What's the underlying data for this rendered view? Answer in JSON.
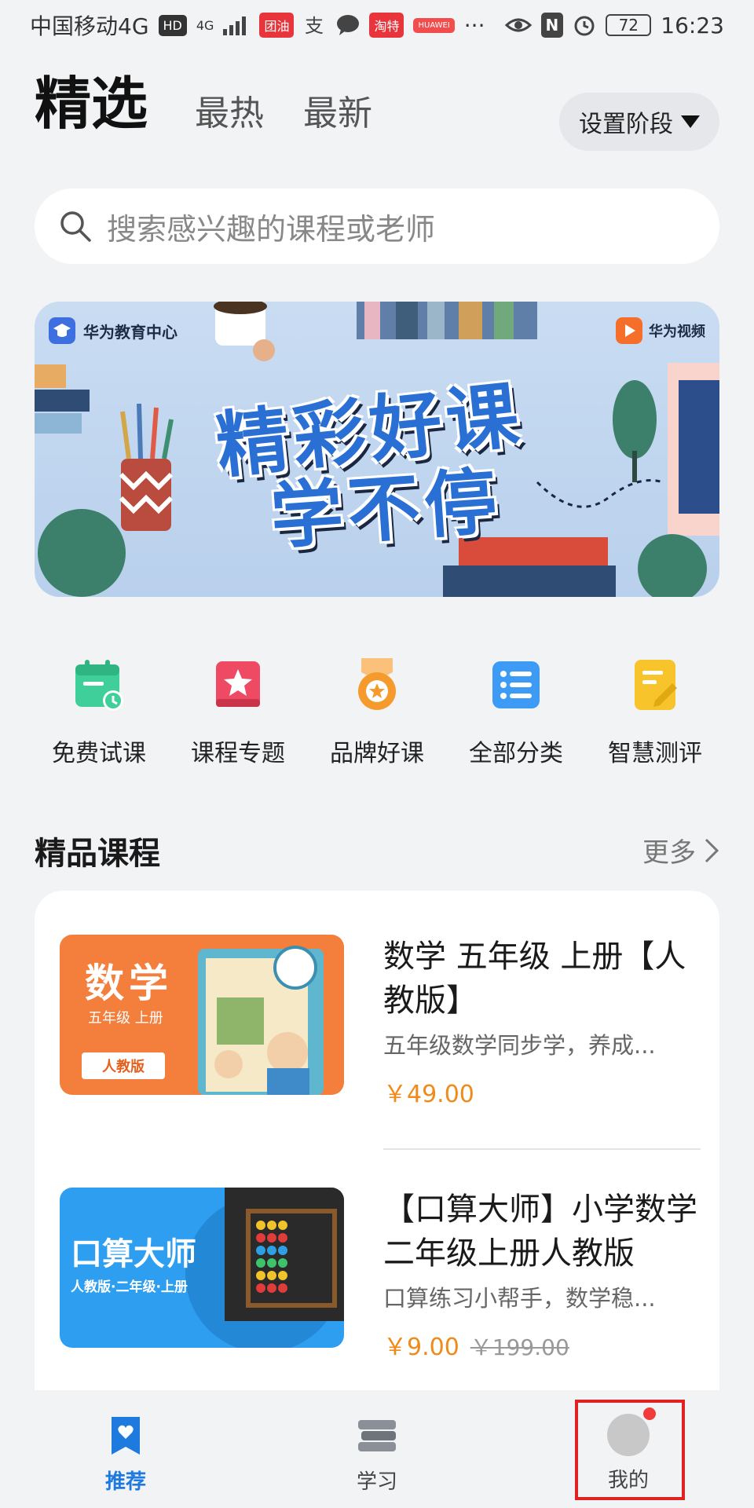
{
  "status_bar": {
    "carrier": "中国移动4G",
    "hd": "HD",
    "net": "4G",
    "app1": "团油",
    "app2": "淘特",
    "app3": "HUAWEI",
    "more": "···",
    "nfc": "N",
    "battery": "72",
    "time": "16:23"
  },
  "header": {
    "tabs": [
      {
        "label": "精选"
      },
      {
        "label": "最热"
      },
      {
        "label": "最新"
      }
    ],
    "stage_button": "设置阶段"
  },
  "search": {
    "placeholder": "搜索感兴趣的课程或老师"
  },
  "banner": {
    "left_logo": "华为教育中心",
    "right_logo": "华为视频",
    "title_line1": "精彩好课",
    "title_line2": "学不停"
  },
  "quick_menu": [
    {
      "label": "免费试课",
      "icon": "calendar-clock-icon",
      "color": "#3fcf9a"
    },
    {
      "label": "课程专题",
      "icon": "star-book-icon",
      "color": "#ef4a63"
    },
    {
      "label": "品牌好课",
      "icon": "medal-icon",
      "color": "#f59a2c"
    },
    {
      "label": "全部分类",
      "icon": "list-icon",
      "color": "#3d9bf5"
    },
    {
      "label": "智慧测评",
      "icon": "edit-note-icon",
      "color": "#f7c52b"
    }
  ],
  "section": {
    "title": "精品课程",
    "more": "更多"
  },
  "courses": [
    {
      "thumb_title": "数学",
      "thumb_sub": "五年级 上册",
      "thumb_badge": "人教版",
      "title": "数学 五年级 上册【人教版】",
      "desc": "五年级数学同步学，养成...",
      "price": "￥49.00"
    },
    {
      "thumb_title": "口算大师",
      "thumb_sub": "人教版·二年级·上册",
      "title": "【口算大师】小学数学二年级上册人教版",
      "desc": "口算练习小帮手，数学稳...",
      "price": "￥9.00",
      "old_price": "￥199.00"
    }
  ],
  "bottom_nav": [
    {
      "label": "推荐",
      "icon": "heart-bookmark-icon",
      "active": true
    },
    {
      "label": "学习",
      "icon": "books-icon",
      "active": false
    },
    {
      "label": "我的",
      "icon": "avatar-icon",
      "active": false
    }
  ],
  "colors": {
    "accent": "#1f7ae0",
    "price": "#f08a1a",
    "highlight": "#e02222"
  }
}
